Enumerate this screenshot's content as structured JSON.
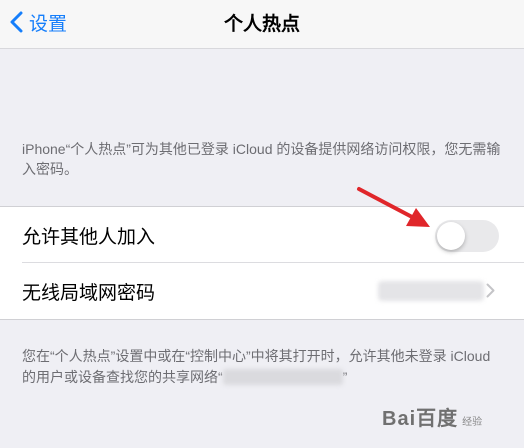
{
  "navbar": {
    "back_label": "设置",
    "title": "个人热点"
  },
  "description": "iPhone“个人热点”可为其他已登录 iCloud 的设备提供网络访问权限，您无需输入密码。",
  "settings": {
    "allow_others_label": "允许其他人加入",
    "allow_others_enabled": false,
    "wifi_password_label": "无线局域网密码"
  },
  "footer": {
    "text": "您在“个人热点”设置中或在“控制中心”中将其打开时，允许其他未登录 iCloud 的用户或设备查找您的共享网络“",
    "end_quote": "”"
  },
  "watermark": {
    "brand": "Bai百度",
    "sub": "经验"
  },
  "colors": {
    "accent": "#157efb",
    "annotation_arrow": "#e0262a",
    "background": "#efeff4",
    "toggle_off": "#e9e9eb"
  },
  "icons": {
    "back": "chevron-left-icon",
    "disclosure": "chevron-right-icon",
    "annotation": "red-arrow-icon"
  }
}
